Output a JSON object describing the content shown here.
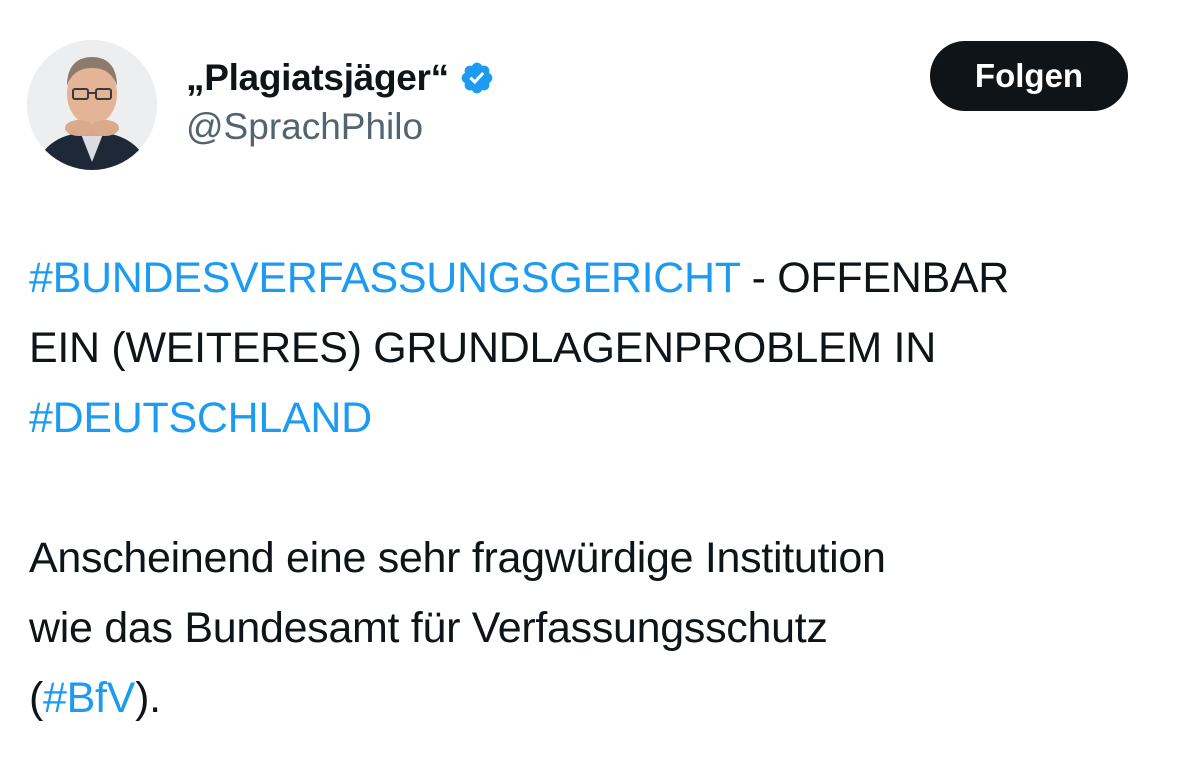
{
  "author": {
    "display_name": "„Plagiatsjäger“",
    "handle": "@SprachPhilo",
    "verified": true,
    "avatar": "profile-photo-man-glasses"
  },
  "follow_button": {
    "label": "Folgen"
  },
  "tweet": {
    "hashtag_bverfg": "#BUNDESVERFASSUNGSGERICHT",
    "text_1a": " - OFFENBAR",
    "text_1b": "EIN (WEITERES) GRUNDLAGENPROBLEM IN",
    "hashtag_deutschland": "#DEUTSCHLAND",
    "text_2a": "Anscheinend eine sehr fragwürdige Institution",
    "text_2b": "wie das Bundesamt für Verfassungsschutz",
    "paren_open": "(",
    "hashtag_bfv": "#BfV",
    "text_2c": ")."
  },
  "colors": {
    "text": "#0f1419",
    "secondary": "#536471",
    "link": "#1d9bf0",
    "button_bg": "#0f1419",
    "verified": "#1d9bf0"
  }
}
